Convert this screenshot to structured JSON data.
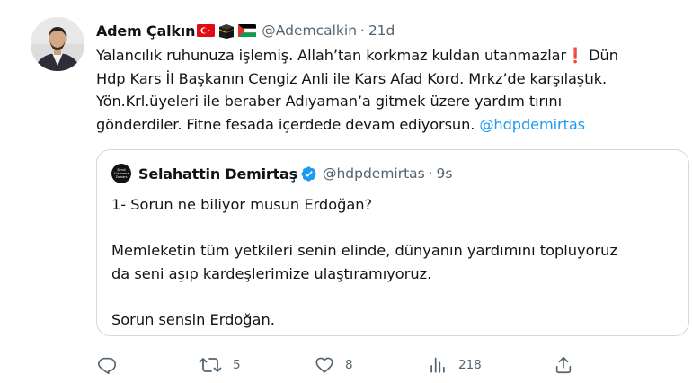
{
  "tweet": {
    "author_name": "Adem Çalkın",
    "author_handle": "@Ademcalkin",
    "separator": "·",
    "time": "21d",
    "text_lines": [
      "Yalancılık ruhunuza işlemiş. Allah’tan korkmaz kuldan utanmazlar",
      "Hdp Kars İl Başkanın Cengiz Anli ile Kars Afad Kord. Mrkz’de karşılaştık.",
      "Yön.Krl.üyeleri ile beraber Adıyaman’a gitmek üzere yardım tırını",
      "gönderdiler. Fitne fesada içerdede devam ediyorsun."
    ],
    "exclamation": "❗",
    "line1_tail": " Dün",
    "mention": "@hdpdemirtas"
  },
  "quoted": {
    "avatar_text": [
      "Şimdi",
      "Susmama",
      "Zamanı"
    ],
    "author_name": "Selahattin Demirtaş",
    "author_handle": "@hdpdemirtas",
    "separator": "·",
    "time": "9s",
    "lines": [
      "1- Sorun ne biliyor musun Erdoğan?",
      "Memleketin tüm yetkileri senin elinde, dünyanın yardımını topluyoruz",
      "da seni aşıp kardeşlerimize ulaştıramıyoruz.",
      "Sorun sensin Erdoğan."
    ]
  },
  "actions": {
    "reply": "",
    "retweet": "5",
    "like": "8",
    "views": "218"
  },
  "colors": {
    "accent": "#1d9bf0",
    "muted": "#536471",
    "border": "#cfd9de",
    "text": "#0f1419"
  }
}
